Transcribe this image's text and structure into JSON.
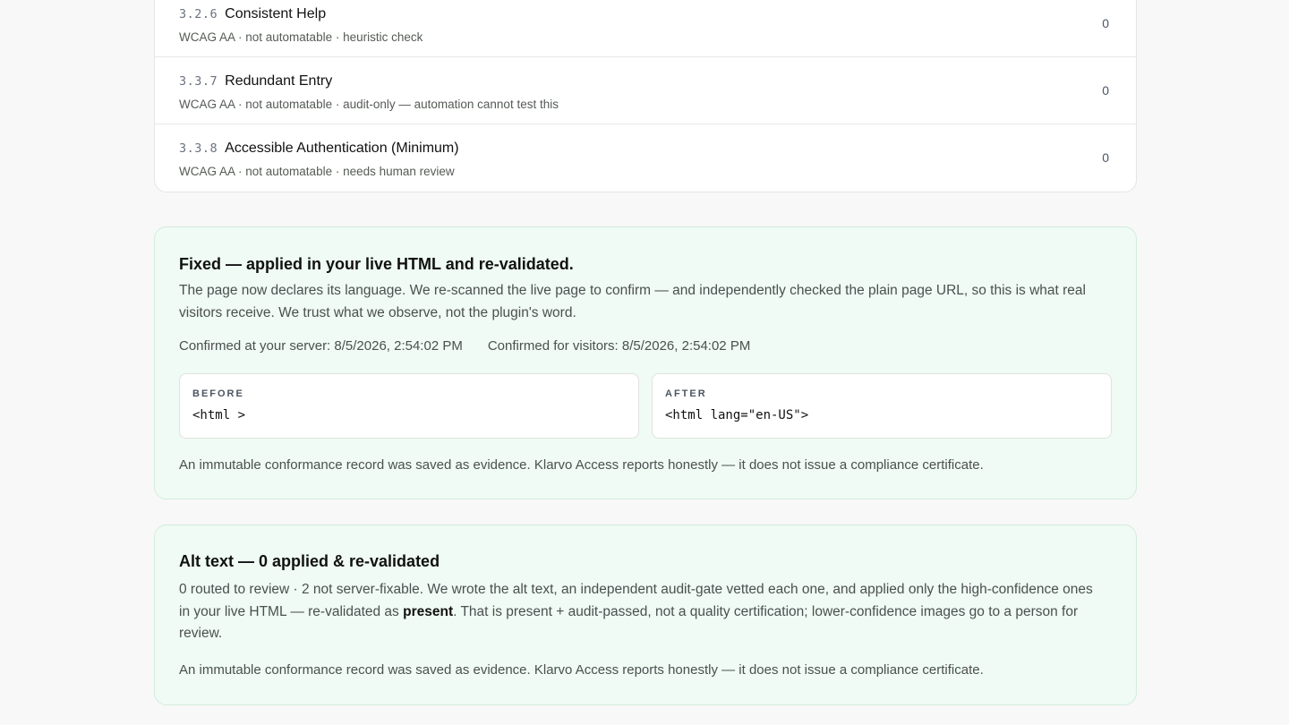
{
  "criteria": [
    {
      "code": "3.2.6",
      "title": "Consistent Help",
      "meta": "WCAG AA · not automatable · heuristic check",
      "count": "0"
    },
    {
      "code": "3.3.7",
      "title": "Redundant Entry",
      "meta": "WCAG AA · not automatable · audit-only — automation cannot test this",
      "count": "0"
    },
    {
      "code": "3.3.8",
      "title": "Accessible Authentication (Minimum)",
      "meta": "WCAG AA · not automatable · needs human review",
      "count": "0"
    }
  ],
  "fixed_panel": {
    "title": "Fixed — applied in your live HTML and re-validated.",
    "body": "The page now declares its language. We re-scanned the live page to confirm — and independently checked the plain page URL, so this is what real visitors receive. We trust what we observe, not the plugin's word.",
    "confirmed_server": "Confirmed at your server: 8/5/2026, 2:54:02 PM",
    "confirmed_visitors": "Confirmed for visitors: 8/5/2026, 2:54:02 PM",
    "before_label": "BEFORE",
    "before_code": "<html >",
    "after_label": "AFTER",
    "after_code": "<html lang=\"en-US\">",
    "evidence": "An immutable conformance record was saved as evidence. Klarvo Access reports honestly — it does not issue a compliance certificate."
  },
  "alt_panel": {
    "title": "Alt text — 0 applied & re-validated",
    "body_before": "0 routed to review · 2 not server-fixable. We wrote the alt text, an independent audit-gate vetted each one, and applied only the high-confidence ones in your live HTML — re-validated as ",
    "body_bold": "present",
    "body_after": ". That is present + audit-passed, not a quality certification; lower-confidence images go to a person for review.",
    "evidence": "An immutable conformance record was saved as evidence. Klarvo Access reports honestly — it does not issue a compliance certificate."
  },
  "colors": {
    "panel_bg": "#effbf4",
    "panel_border": "#d4ecde",
    "page_bg": "#f7f8f7"
  }
}
